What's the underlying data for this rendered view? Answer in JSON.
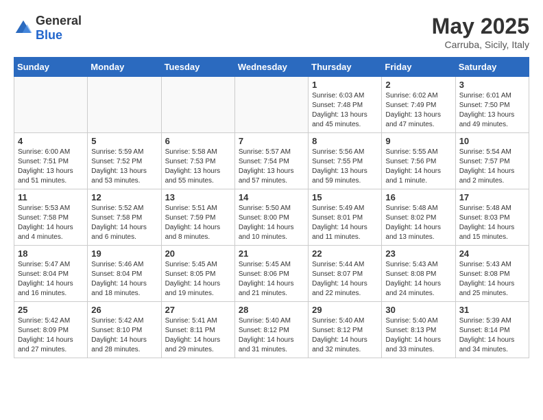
{
  "logo": {
    "general": "General",
    "blue": "Blue"
  },
  "title": "May 2025",
  "subtitle": "Carruba, Sicily, Italy",
  "days_of_week": [
    "Sunday",
    "Monday",
    "Tuesday",
    "Wednesday",
    "Thursday",
    "Friday",
    "Saturday"
  ],
  "weeks": [
    [
      {
        "day": "",
        "info": "",
        "empty": true
      },
      {
        "day": "",
        "info": "",
        "empty": true
      },
      {
        "day": "",
        "info": "",
        "empty": true
      },
      {
        "day": "",
        "info": "",
        "empty": true
      },
      {
        "day": "1",
        "info": "Sunrise: 6:03 AM\nSunset: 7:48 PM\nDaylight: 13 hours\nand 45 minutes."
      },
      {
        "day": "2",
        "info": "Sunrise: 6:02 AM\nSunset: 7:49 PM\nDaylight: 13 hours\nand 47 minutes."
      },
      {
        "day": "3",
        "info": "Sunrise: 6:01 AM\nSunset: 7:50 PM\nDaylight: 13 hours\nand 49 minutes."
      }
    ],
    [
      {
        "day": "4",
        "info": "Sunrise: 6:00 AM\nSunset: 7:51 PM\nDaylight: 13 hours\nand 51 minutes."
      },
      {
        "day": "5",
        "info": "Sunrise: 5:59 AM\nSunset: 7:52 PM\nDaylight: 13 hours\nand 53 minutes."
      },
      {
        "day": "6",
        "info": "Sunrise: 5:58 AM\nSunset: 7:53 PM\nDaylight: 13 hours\nand 55 minutes."
      },
      {
        "day": "7",
        "info": "Sunrise: 5:57 AM\nSunset: 7:54 PM\nDaylight: 13 hours\nand 57 minutes."
      },
      {
        "day": "8",
        "info": "Sunrise: 5:56 AM\nSunset: 7:55 PM\nDaylight: 13 hours\nand 59 minutes."
      },
      {
        "day": "9",
        "info": "Sunrise: 5:55 AM\nSunset: 7:56 PM\nDaylight: 14 hours\nand 1 minute."
      },
      {
        "day": "10",
        "info": "Sunrise: 5:54 AM\nSunset: 7:57 PM\nDaylight: 14 hours\nand 2 minutes."
      }
    ],
    [
      {
        "day": "11",
        "info": "Sunrise: 5:53 AM\nSunset: 7:58 PM\nDaylight: 14 hours\nand 4 minutes."
      },
      {
        "day": "12",
        "info": "Sunrise: 5:52 AM\nSunset: 7:58 PM\nDaylight: 14 hours\nand 6 minutes."
      },
      {
        "day": "13",
        "info": "Sunrise: 5:51 AM\nSunset: 7:59 PM\nDaylight: 14 hours\nand 8 minutes."
      },
      {
        "day": "14",
        "info": "Sunrise: 5:50 AM\nSunset: 8:00 PM\nDaylight: 14 hours\nand 10 minutes."
      },
      {
        "day": "15",
        "info": "Sunrise: 5:49 AM\nSunset: 8:01 PM\nDaylight: 14 hours\nand 11 minutes."
      },
      {
        "day": "16",
        "info": "Sunrise: 5:48 AM\nSunset: 8:02 PM\nDaylight: 14 hours\nand 13 minutes."
      },
      {
        "day": "17",
        "info": "Sunrise: 5:48 AM\nSunset: 8:03 PM\nDaylight: 14 hours\nand 15 minutes."
      }
    ],
    [
      {
        "day": "18",
        "info": "Sunrise: 5:47 AM\nSunset: 8:04 PM\nDaylight: 14 hours\nand 16 minutes."
      },
      {
        "day": "19",
        "info": "Sunrise: 5:46 AM\nSunset: 8:04 PM\nDaylight: 14 hours\nand 18 minutes."
      },
      {
        "day": "20",
        "info": "Sunrise: 5:45 AM\nSunset: 8:05 PM\nDaylight: 14 hours\nand 19 minutes."
      },
      {
        "day": "21",
        "info": "Sunrise: 5:45 AM\nSunset: 8:06 PM\nDaylight: 14 hours\nand 21 minutes."
      },
      {
        "day": "22",
        "info": "Sunrise: 5:44 AM\nSunset: 8:07 PM\nDaylight: 14 hours\nand 22 minutes."
      },
      {
        "day": "23",
        "info": "Sunrise: 5:43 AM\nSunset: 8:08 PM\nDaylight: 14 hours\nand 24 minutes."
      },
      {
        "day": "24",
        "info": "Sunrise: 5:43 AM\nSunset: 8:08 PM\nDaylight: 14 hours\nand 25 minutes."
      }
    ],
    [
      {
        "day": "25",
        "info": "Sunrise: 5:42 AM\nSunset: 8:09 PM\nDaylight: 14 hours\nand 27 minutes."
      },
      {
        "day": "26",
        "info": "Sunrise: 5:42 AM\nSunset: 8:10 PM\nDaylight: 14 hours\nand 28 minutes."
      },
      {
        "day": "27",
        "info": "Sunrise: 5:41 AM\nSunset: 8:11 PM\nDaylight: 14 hours\nand 29 minutes."
      },
      {
        "day": "28",
        "info": "Sunrise: 5:40 AM\nSunset: 8:12 PM\nDaylight: 14 hours\nand 31 minutes."
      },
      {
        "day": "29",
        "info": "Sunrise: 5:40 AM\nSunset: 8:12 PM\nDaylight: 14 hours\nand 32 minutes."
      },
      {
        "day": "30",
        "info": "Sunrise: 5:40 AM\nSunset: 8:13 PM\nDaylight: 14 hours\nand 33 minutes."
      },
      {
        "day": "31",
        "info": "Sunrise: 5:39 AM\nSunset: 8:14 PM\nDaylight: 14 hours\nand 34 minutes."
      }
    ]
  ]
}
